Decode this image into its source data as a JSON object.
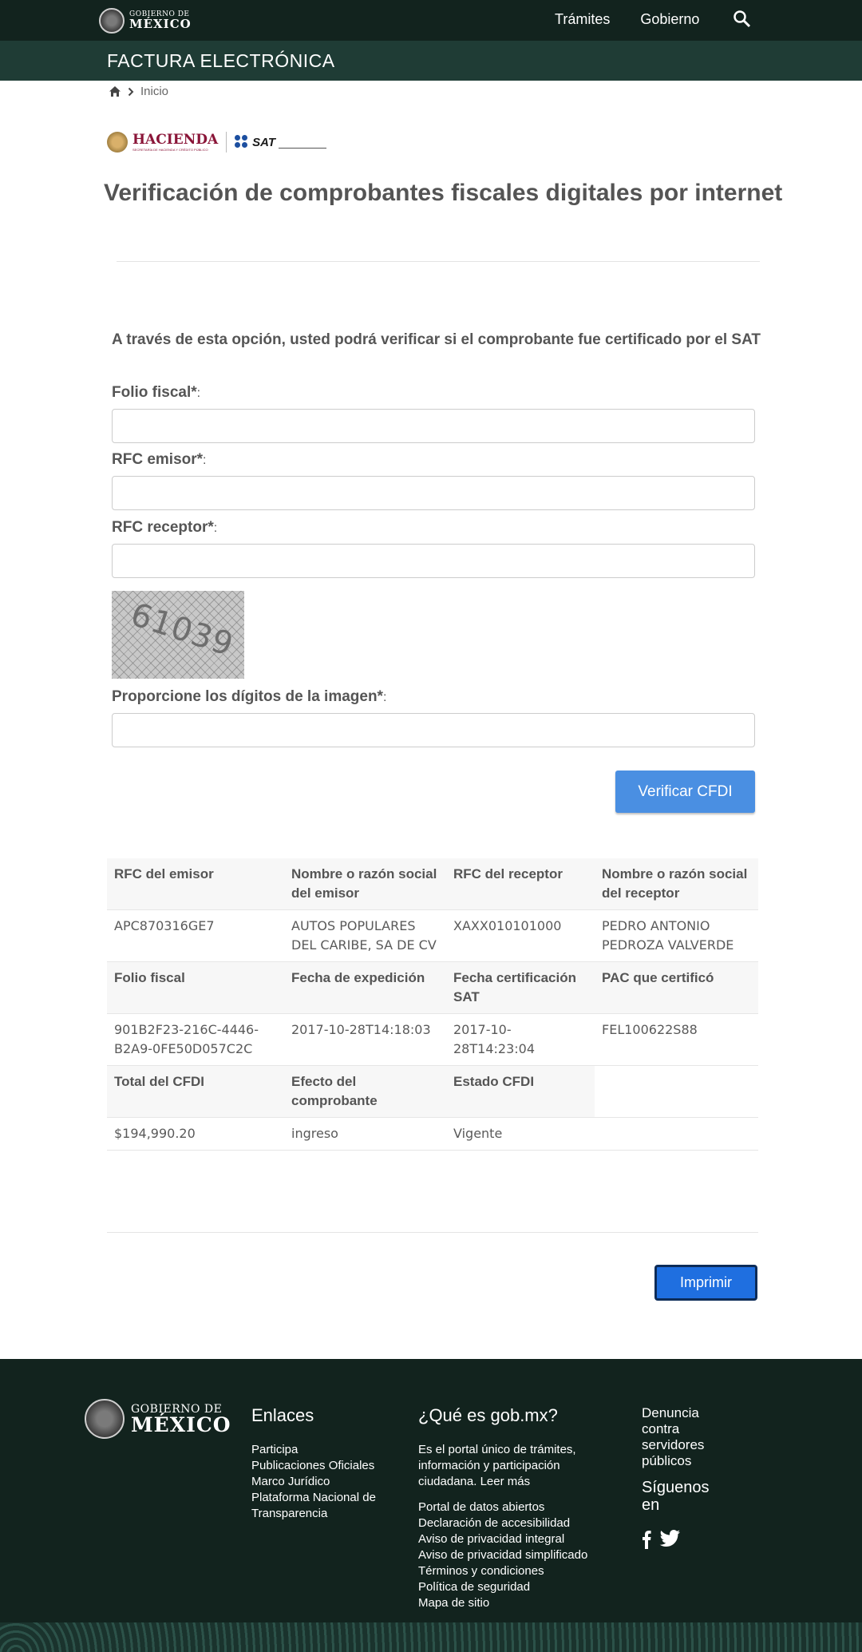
{
  "header": {
    "logo_line1": "GOBIERNO DE",
    "logo_line2": "MÉXICO",
    "nav": [
      "Trámites",
      "Gobierno"
    ],
    "section_title": "FACTURA ELECTRÓNICA"
  },
  "breadcrumb": {
    "home": "Inicio"
  },
  "logos": {
    "hacienda": "HACIENDA",
    "hacienda_sub": "SECRETARÍA DE HACIENDA Y CRÉDITO PÚBLICO",
    "sat": "SAT"
  },
  "page_title": "Verificación de comprobantes fiscales digitales por internet",
  "intro": "A través de esta opción, usted podrá verificar si el comprobante fue certificado por el SAT",
  "form": {
    "folio_label": "Folio fiscal*",
    "emisor_label": "RFC emisor*",
    "receptor_label": "RFC receptor*",
    "captcha_digits": "61039",
    "captcha_label": "Proporcione los dígitos de la imagen*",
    "colon": ":",
    "folio_value": "",
    "emisor_value": "",
    "receptor_value": "",
    "captcha_value": "",
    "verify_button": "Verificar CFDI"
  },
  "results": {
    "row1_headers": [
      "RFC del emisor",
      "Nombre o razón social del emisor",
      "RFC del receptor",
      "Nombre o razón social del receptor"
    ],
    "row1_values": [
      "APC870316GE7",
      "AUTOS POPULARES DEL CARIBE, SA DE CV",
      "XAXX010101000",
      "PEDRO ANTONIO PEDROZA VALVERDE"
    ],
    "row2_headers": [
      "Folio fiscal",
      "Fecha de expedición",
      "Fecha certificación SAT",
      "PAC que certificó"
    ],
    "row2_values": [
      "901B2F23-216C-4446-B2A9-0FE50D057C2C",
      "2017-10-28T14:18:03",
      "2017-10-28T14:23:04",
      "FEL100622S88"
    ],
    "row3_headers": [
      "Total del CFDI",
      "Efecto del comprobante",
      "Estado CFDI"
    ],
    "row3_values": [
      "$194,990.20",
      "ingreso",
      "Vigente"
    ]
  },
  "print_button": "Imprimir",
  "footer": {
    "logo_line1": "GOBIERNO DE",
    "logo_line2": "MÉXICO",
    "enlaces_title": "Enlaces",
    "enlaces": [
      "Participa",
      "Publicaciones Oficiales",
      "Marco Jurídico",
      "Plataforma Nacional de Transparencia"
    ],
    "que_title": "¿Qué es gob.mx?",
    "que_text": "Es el portal único de trámites, información y participación ciudadana. Leer más",
    "que_links": [
      "Portal de datos abiertos",
      "Declaración de accesibilidad",
      "Aviso de privacidad integral",
      "Aviso de privacidad simplificado",
      "Términos y condiciones",
      "Política de seguridad",
      "Mapa de sitio"
    ],
    "denuncia": "Denuncia contra servidores públicos",
    "siguenos": "Síguenos en"
  },
  "icons": {
    "search": "search-icon",
    "home": "home-icon",
    "chevron": "chevron-right-icon",
    "facebook": "facebook-icon",
    "twitter": "twitter-icon"
  },
  "colors": {
    "header_bg": "#12231e",
    "subbar_bg": "#1f3c35",
    "verify_btn": "#4a8fe2",
    "print_btn": "#1f6fe0",
    "hacienda": "#8a1538"
  }
}
